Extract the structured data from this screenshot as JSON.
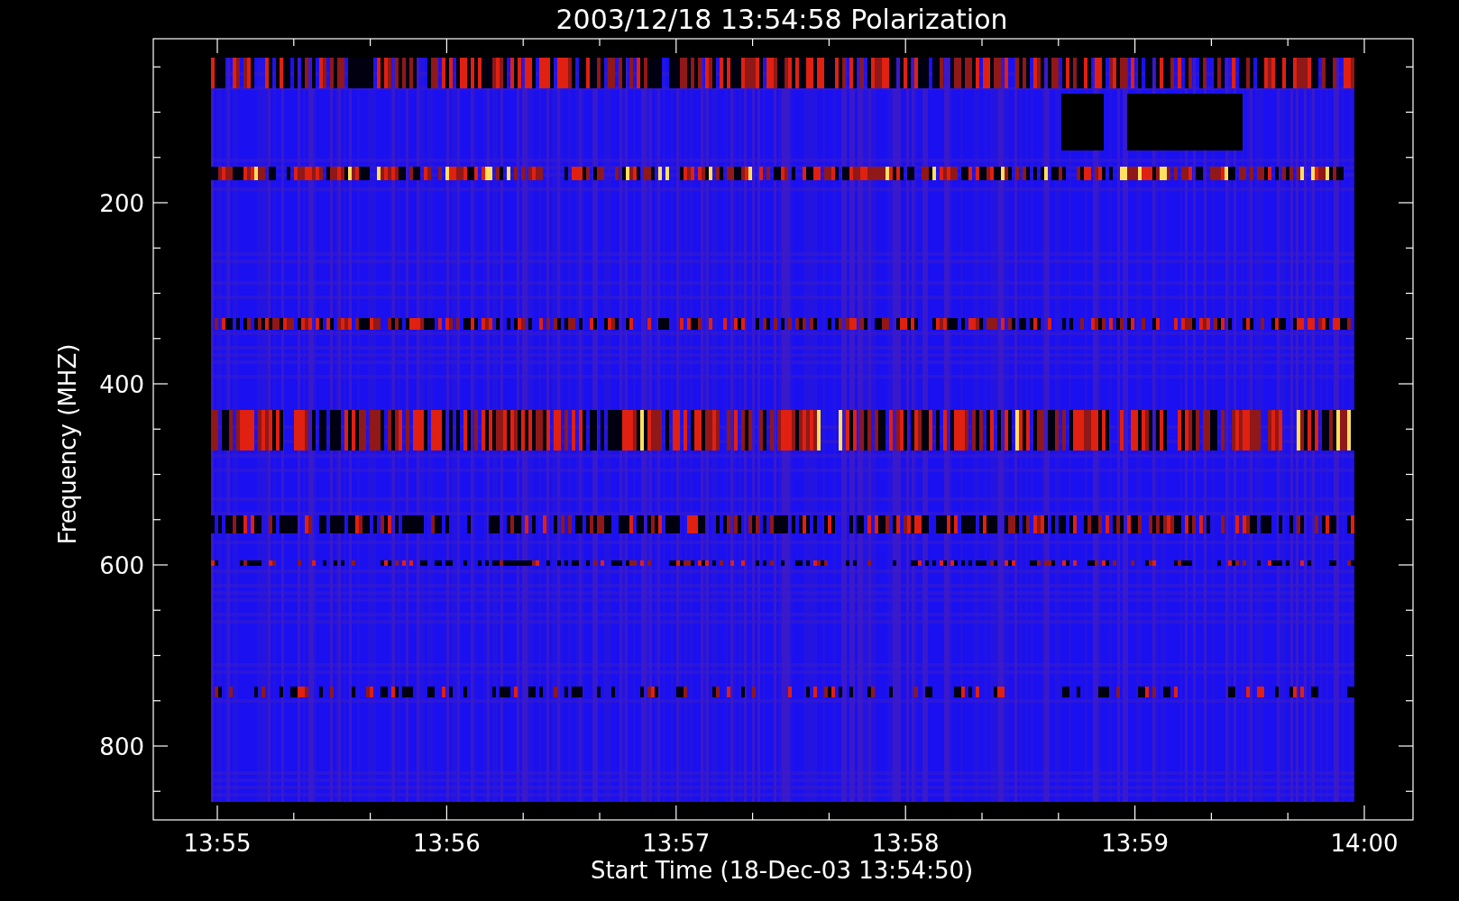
{
  "plot": {
    "title": "2003/12/18 13:54:58 Polarization",
    "xlabel": "Start Time (18-Dec-03 13:54:50)",
    "ylabel": "Frequency (MHZ)",
    "xticks": [
      "13:55",
      "13:56",
      "13:57",
      "13:58",
      "13:59",
      "14:00"
    ],
    "yticks": [
      "200",
      "400",
      "600",
      "800"
    ]
  }
}
